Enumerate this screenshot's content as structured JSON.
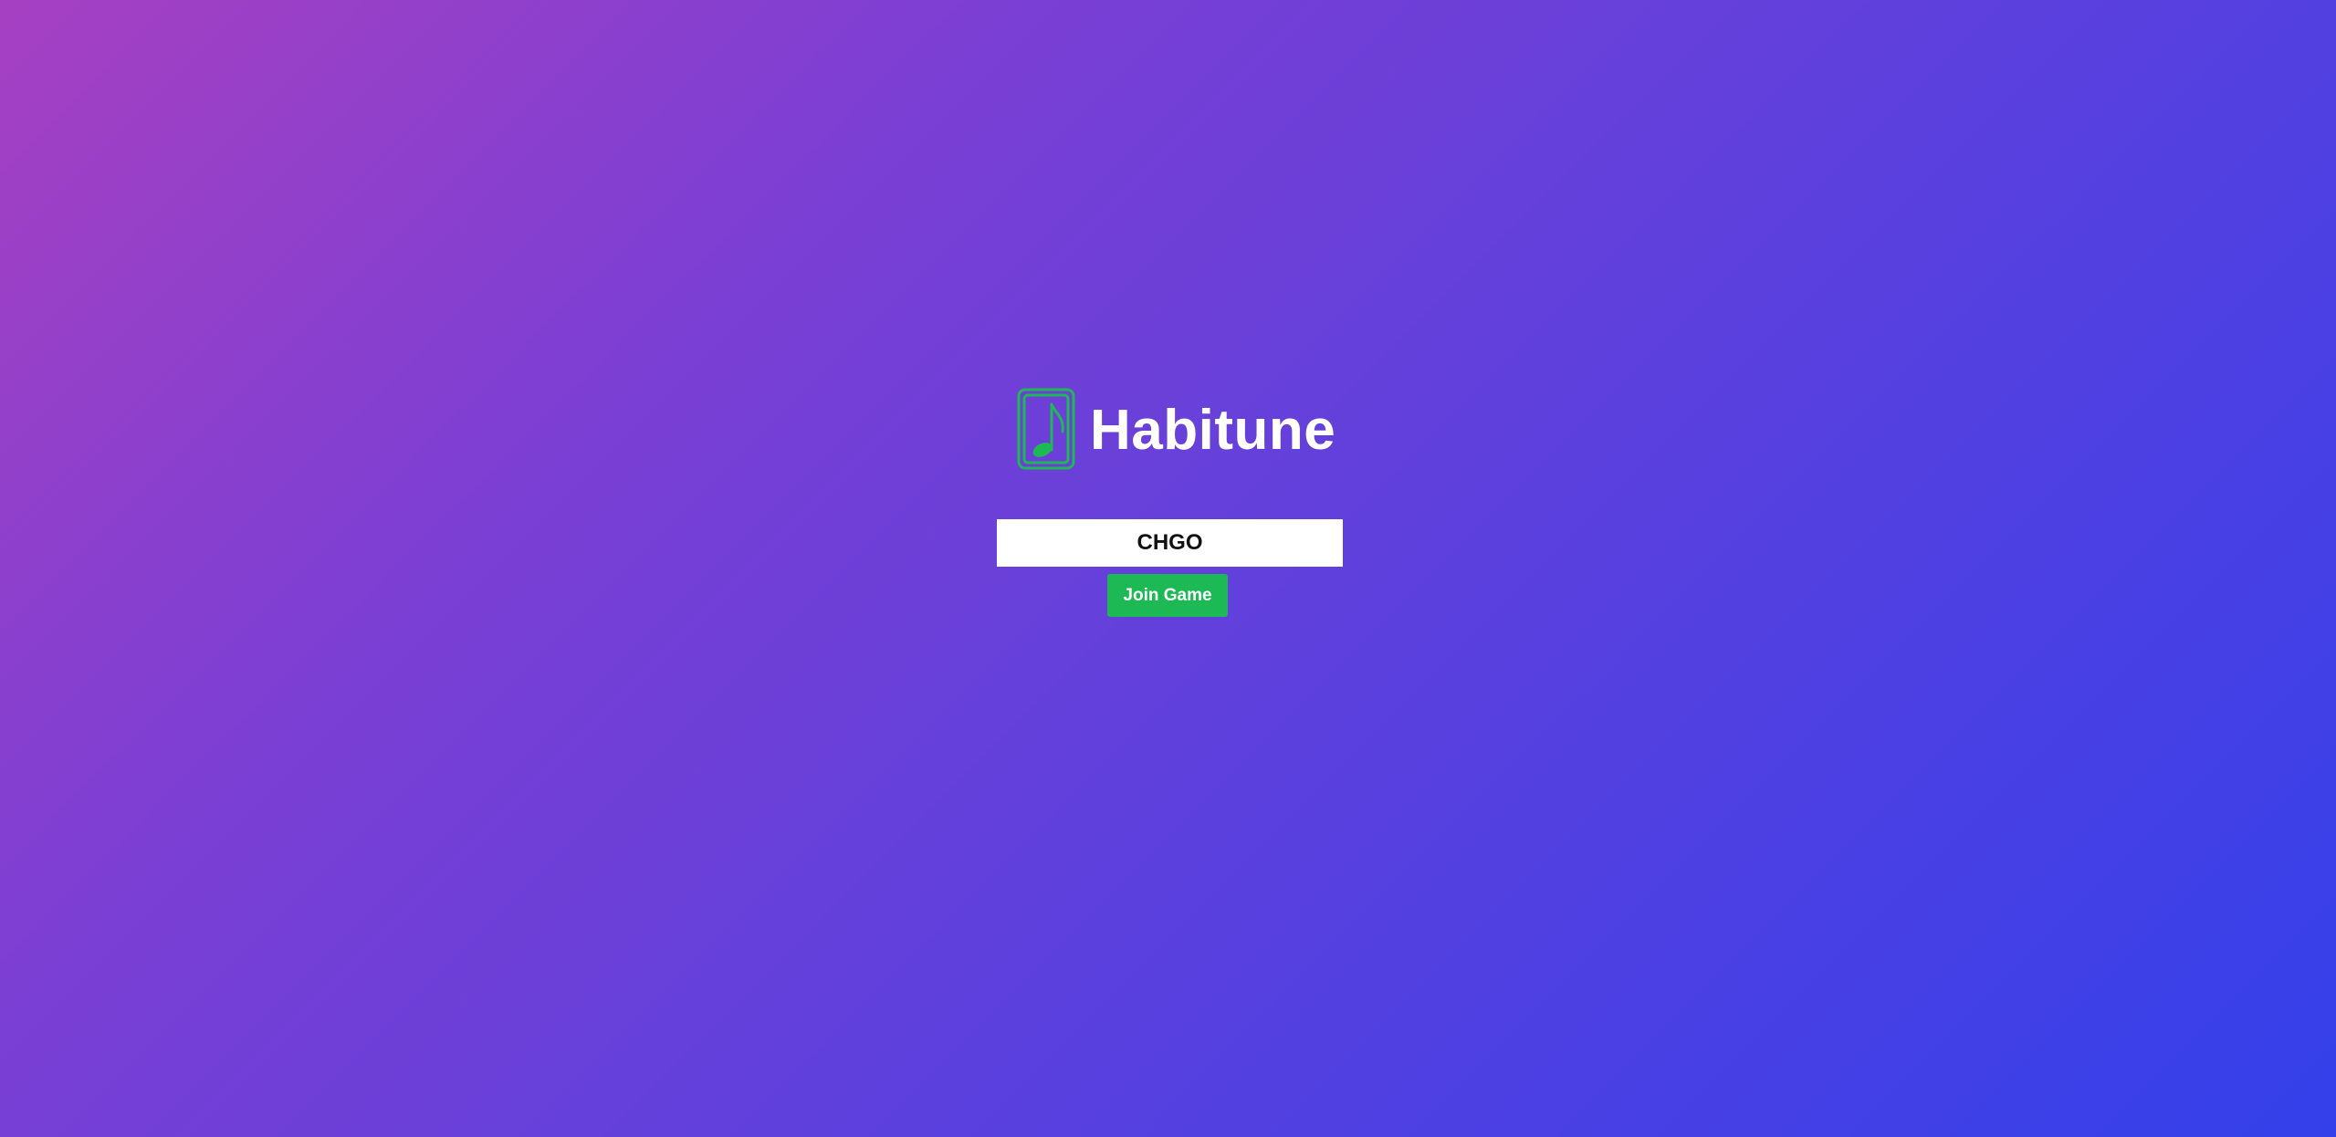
{
  "brand": {
    "name": "Habitune",
    "logo_icon": "music-note-card-icon",
    "accent_color": "#1db954"
  },
  "join_form": {
    "code_value": "CHGO",
    "join_button_label": "Join Game"
  },
  "background": {
    "gradient_start": "#a640c2",
    "gradient_end": "#3440ea"
  }
}
